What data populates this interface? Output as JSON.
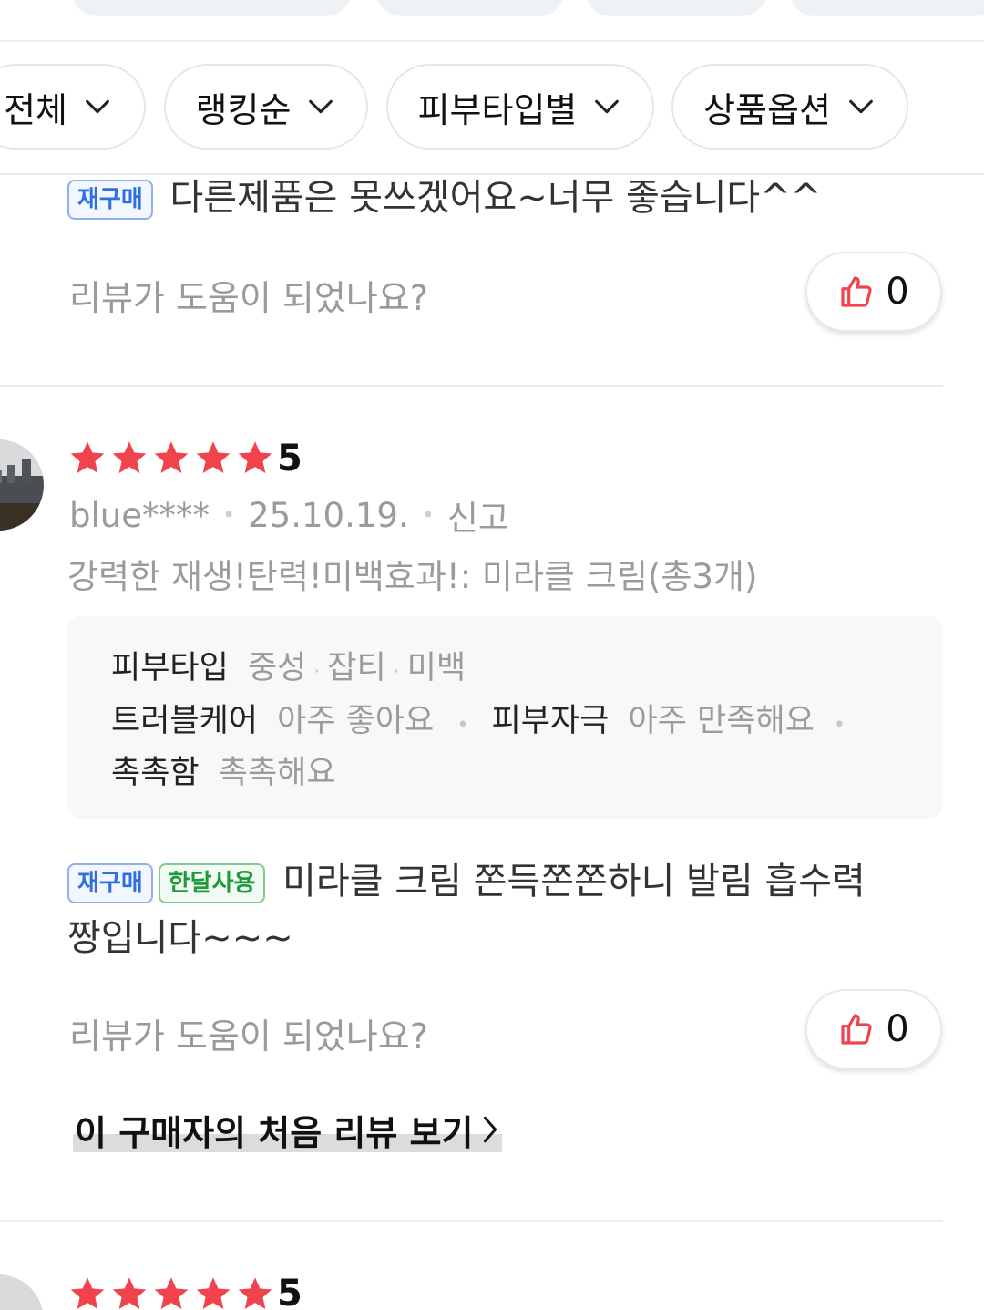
{
  "filters": {
    "all_label": "전체",
    "ranking_label": "랭킹순",
    "skin_type_label": "피부타입별",
    "product_option_label": "상품옵션"
  },
  "colors": {
    "star": "#f0434d",
    "thumb": "#f0434d",
    "tag_repurchase": "#2f6fe0",
    "tag_month_use": "#1f9a3a"
  },
  "icons": {
    "dropdown": "chevron-down-icon",
    "like": "thumbs-up-icon",
    "star": "star-icon",
    "more": "chevron-right-icon"
  },
  "reviews": [
    {
      "tags": [
        "재구매"
      ],
      "text": "다른제품은 못쓰겠어요~너무 좋습니다^^",
      "helpful_question": "리뷰가 도움이 되었나요?",
      "likes": "0"
    },
    {
      "rating": 5,
      "rating_label": "5",
      "user": "blue****",
      "date": "25.10.19.",
      "report_label": "신고",
      "option": "강력한 재생!탄력!미백효과!: 미라클 크림(총3개)",
      "details": {
        "skin_type_label": "피부타입",
        "skin_type_values": [
          "중성",
          "잡티",
          "미백"
        ],
        "trouble_label": "트러블케어",
        "trouble_value": "아주 좋아요",
        "irritation_label": "피부자극",
        "irritation_value": "아주 만족해요",
        "moist_label": "촉촉함",
        "moist_value": "촉촉해요"
      },
      "tags": [
        "재구매",
        "한달사용"
      ],
      "text_line1": "미라클 크림 쫀득쫀쫀하니 발림 흡수력",
      "text_line2": "짱입니다~~~",
      "helpful_question": "리뷰가 도움이 되었나요?",
      "likes": "0",
      "first_review_link": "이 구매자의 처음 리뷰 보기"
    },
    {
      "rating": 5,
      "rating_label": "5"
    }
  ]
}
